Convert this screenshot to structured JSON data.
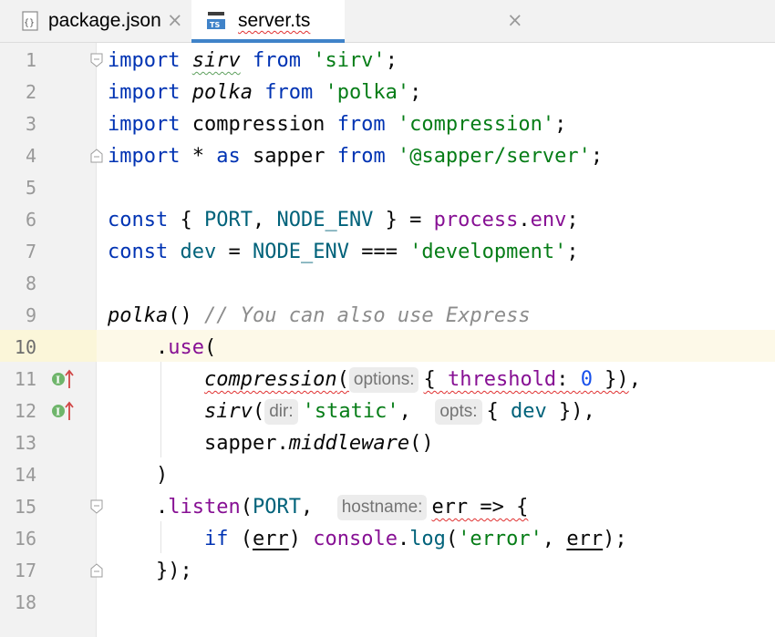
{
  "tabs": [
    {
      "label": "package.json",
      "icon": "json-file-icon",
      "close": "×",
      "active": false
    },
    {
      "label": "server.ts",
      "icon": "typescript-file-icon",
      "close": "×",
      "active": true
    }
  ],
  "gutter": {
    "line_numbers": [
      "1",
      "2",
      "3",
      "4",
      "5",
      "6",
      "7",
      "8",
      "9",
      "10",
      "11",
      "12",
      "13",
      "14",
      "15",
      "16",
      "17",
      "18"
    ],
    "current_line": "10",
    "implement_markers": [
      "11",
      "12"
    ]
  },
  "code": {
    "l1": {
      "a": "import",
      "b": "sirv",
      "c": "from",
      "d": "'sirv'",
      "e": ";"
    },
    "l2": {
      "a": "import",
      "b": "polka",
      "c": "from",
      "d": "'polka'",
      "e": ";"
    },
    "l3": {
      "a": "import",
      "b": "compression",
      "c": "from",
      "d": "'compression'",
      "e": ";"
    },
    "l4": {
      "a": "import",
      "b": "*",
      "c": "as",
      "d": "sapper",
      "e": "from",
      "f": "'@sapper/server'",
      "g": ";"
    },
    "l6": {
      "a": "const",
      "b": "{ ",
      "c": "PORT",
      "d": ", ",
      "e": "NODE_ENV",
      "f": " } = ",
      "g": "process",
      "h": ".",
      "i": "env",
      "j": ";"
    },
    "l7": {
      "a": "const",
      "b": "dev",
      "c": " = ",
      "d": "NODE_ENV",
      "e": " === ",
      "f": "'development'",
      "g": ";"
    },
    "l9": {
      "a": "polka",
      "b": "() ",
      "c": "// You can also use Express"
    },
    "l10": {
      "a": ".",
      "b": "use",
      "c": "("
    },
    "l11": {
      "a": "compression",
      "b": "(",
      "hint": "options:",
      "c": "{ ",
      "d": "threshold",
      "e": ": ",
      "f": "0",
      "g": " })",
      "h": ","
    },
    "l12": {
      "a": "sirv",
      "b": "(",
      "hint1": "dir:",
      "c": "'static'",
      "d": ",",
      "hint2": "opts:",
      "e": "{ ",
      "f": "dev",
      "g": " }),"
    },
    "l13": {
      "a": "sapper",
      "b": ".",
      "c": "middleware",
      "d": "()"
    },
    "l14": {
      "a": ")"
    },
    "l15": {
      "a": ".",
      "b": "listen",
      "c": "(",
      "d": "PORT",
      "e": ",",
      "hint": "hostname:",
      "f": "err => {"
    },
    "l16": {
      "a": "if",
      "b": " (",
      "c": "err",
      "d": ") ",
      "e": "console",
      "f": ".",
      "g": "log",
      "h": "(",
      "i": "'error'",
      "j": ", ",
      "k": "err",
      "l": ");"
    },
    "l17": {
      "a": "});"
    }
  }
}
